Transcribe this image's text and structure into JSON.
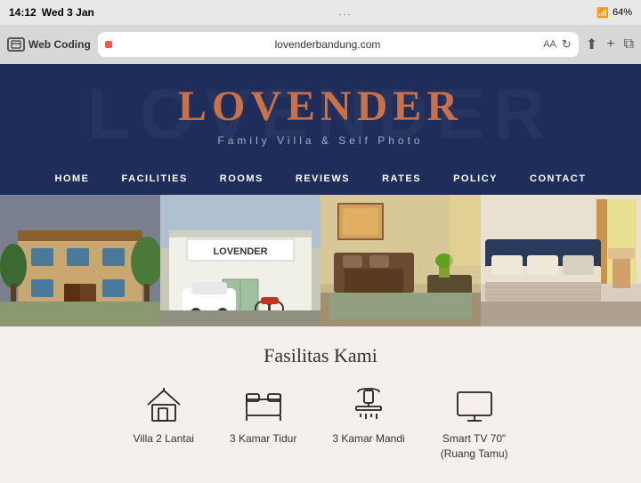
{
  "statusBar": {
    "time": "14:12",
    "day": "Wed 3 Jan",
    "tabLabel": "Web Coding",
    "dots": "...",
    "batteryPercent": "64%"
  },
  "urlBar": {
    "url": "lovenderbandung.com",
    "aaLabel": "AA"
  },
  "hero": {
    "title": "LOVENDER",
    "subtitle": "Family Villa & Self Photo",
    "bgText": "LOVENDER"
  },
  "nav": {
    "items": [
      {
        "label": "HOME"
      },
      {
        "label": "FACILITIES"
      },
      {
        "label": "ROOMS"
      },
      {
        "label": "REVIEWS"
      },
      {
        "label": "RATES"
      },
      {
        "label": "POLICY"
      },
      {
        "label": "CONTACT"
      }
    ]
  },
  "photos": [
    {
      "alt": "exterior building"
    },
    {
      "alt": "lovender sign with car",
      "sign": "LOVENDER"
    },
    {
      "alt": "living room sofa"
    },
    {
      "alt": "bedroom"
    }
  ],
  "facilities": {
    "title": "Fasilitas Kami",
    "items": [
      {
        "label": "Villa 2 Lantai",
        "icon": "house"
      },
      {
        "label": "3 Kamar Tidur",
        "icon": "bed"
      },
      {
        "label": "3 Kamar Mandi",
        "icon": "shower"
      },
      {
        "label": "Smart TV 70\"\n(Ruang Tamu)",
        "icon": "tv"
      }
    ]
  }
}
